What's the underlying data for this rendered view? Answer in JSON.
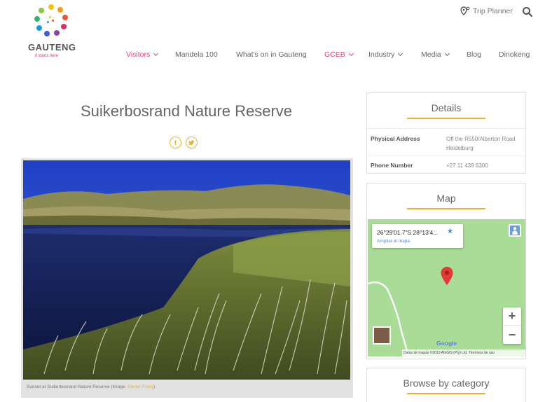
{
  "header": {
    "logo_word": "GAUTENG",
    "logo_tagline": "it starts here",
    "trip_planner": "Trip Planner",
    "nav": [
      {
        "label": "Visitors",
        "dropdown": true,
        "accent": true
      },
      {
        "label": "Mandela 100",
        "dropdown": false,
        "accent": false
      },
      {
        "label": "What's on in Gauteng",
        "dropdown": false,
        "accent": false
      },
      {
        "label": "GCEB",
        "dropdown": true,
        "accent": true
      },
      {
        "label": "Industry",
        "dropdown": true,
        "accent": false
      },
      {
        "label": "Media",
        "dropdown": true,
        "accent": false
      },
      {
        "label": "Blog",
        "dropdown": false,
        "accent": false
      },
      {
        "label": "Dinokeng",
        "dropdown": false,
        "accent": false
      }
    ]
  },
  "main": {
    "title": "Suikerbosrand Nature Reserve",
    "share": {
      "facebook": "f",
      "twitter": "t"
    },
    "caption": "Sunset at Suikerbosrand Nature Reserve (Image: ",
    "caption_credit": "Daniel Fraay",
    "caption_end": ")"
  },
  "details": {
    "title": "Details",
    "rows": [
      {
        "label": "Physical Address",
        "value": "Off the R550/Alberton Road Heidelburg"
      },
      {
        "label": "Phone Number",
        "value": "+27 11 439 6300"
      }
    ]
  },
  "map": {
    "title": "Map",
    "coords": "26°29'01.7\"S 28°13'4...",
    "enlarge": "Ampliar el mapa",
    "zoom_in": "+",
    "zoom_out": "−",
    "google": "Google",
    "attribution": "Datos de mapas ©2019 AfriGIS (Pty) Ltd.   Términos de uso"
  },
  "browse": {
    "title": "Browse by category"
  },
  "colors": {
    "accent_pink": "#e0457b",
    "accent_gold": "#e8b230",
    "map_green": "#a9dc97"
  }
}
